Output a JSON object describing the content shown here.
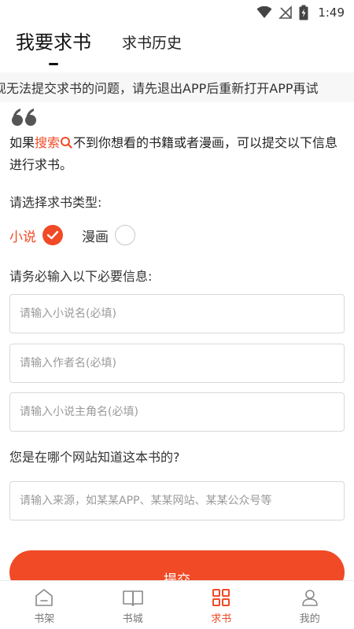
{
  "status_bar": {
    "time": "1:49",
    "icons": [
      "wifi-icon",
      "no-signal-icon",
      "battery-charging-icon"
    ]
  },
  "top_tabs": {
    "active": "我要求书",
    "inactive": "求书历史"
  },
  "notice": {
    "text": "现无法提交求书的问题，请先退出APP后重新打开APP再试"
  },
  "intro": {
    "prefix": "如果",
    "highlight": "搜索",
    "suffix": "不到你想看的书籍或者漫画，可以提交以下信息进行求书。"
  },
  "type_section": {
    "label": "请选择求书类型:",
    "options": [
      {
        "label": "小说",
        "checked": true
      },
      {
        "label": "漫画",
        "checked": false
      }
    ]
  },
  "required_section": {
    "label": "请务必输入以下必要信息:"
  },
  "inputs": {
    "novel_name": {
      "placeholder": "请输入小说名(必填)"
    },
    "author_name": {
      "placeholder": "请输入作者名(必填)"
    },
    "protagonist_name": {
      "placeholder": "请输入小说主角名(必填)"
    },
    "source": {
      "placeholder": "请输入来源，如某某APP、某某网站、某某公众号等"
    }
  },
  "source_section": {
    "label": "您是在哪个网站知道这本书的?"
  },
  "submit": {
    "label": "提交"
  },
  "bottom_nav": {
    "items": [
      {
        "label": "书架",
        "icon": "bookshelf-icon",
        "active": false
      },
      {
        "label": "书城",
        "icon": "book-store-icon",
        "active": false
      },
      {
        "label": "求书",
        "icon": "request-book-icon",
        "active": true
      },
      {
        "label": "我的",
        "icon": "profile-icon",
        "active": false
      }
    ]
  },
  "colors": {
    "accent": "#f04a26",
    "text": "#222222",
    "muted": "#999999",
    "border": "#d9d9d9"
  }
}
